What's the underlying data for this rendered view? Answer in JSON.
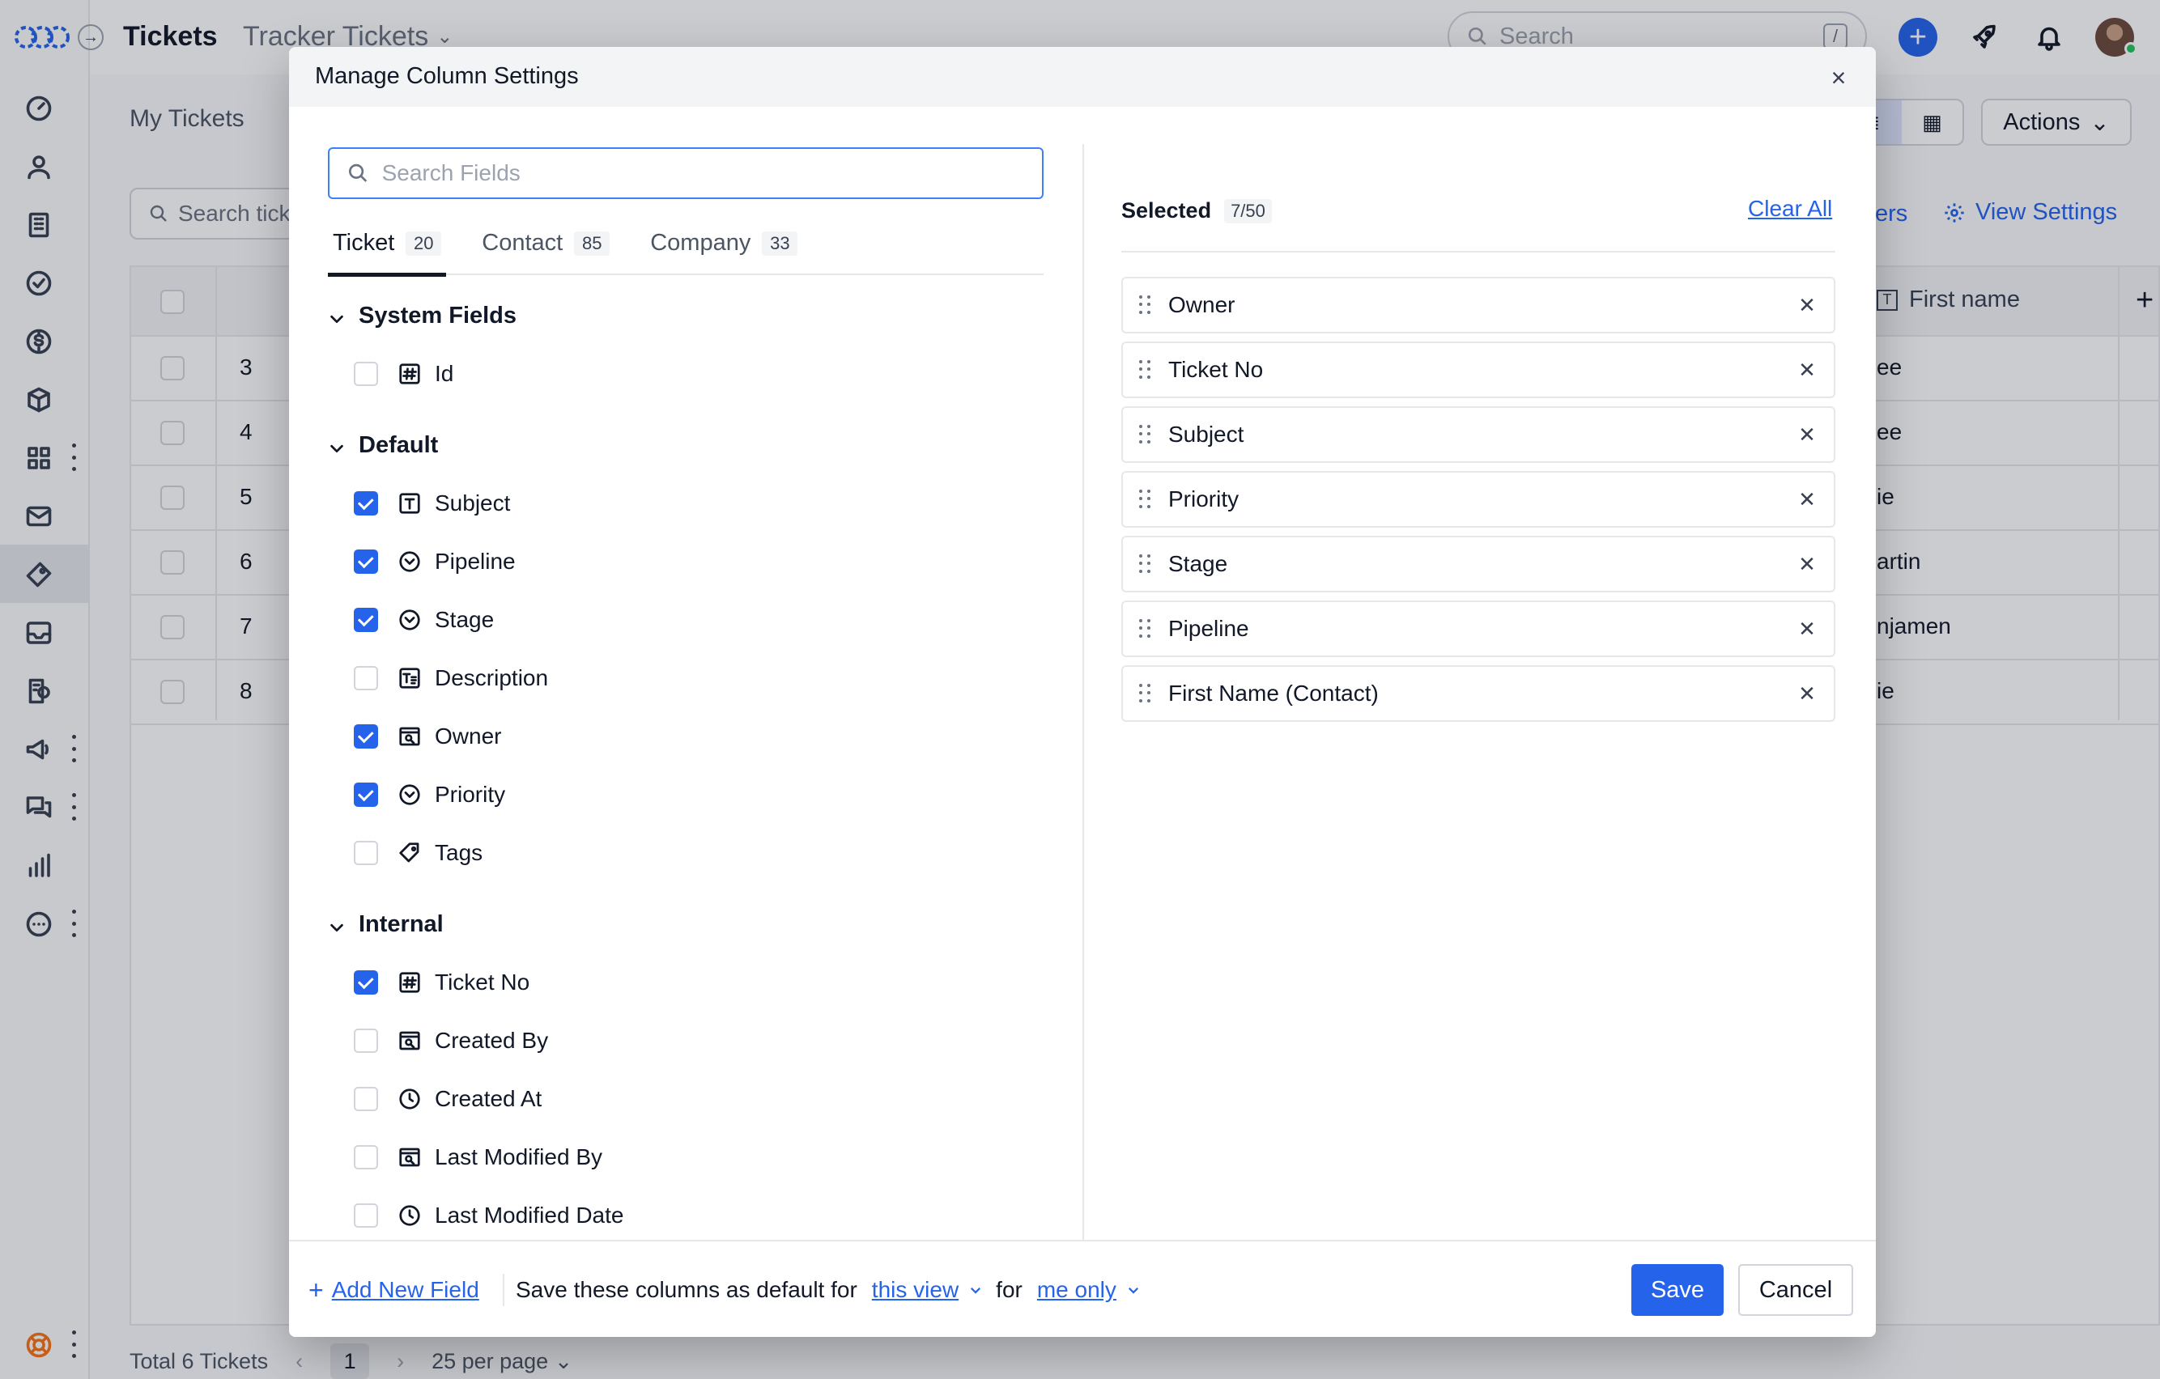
{
  "app": {
    "title": "Tickets",
    "view_title": "Tracker Tickets",
    "search_placeholder": "Search",
    "search_shortcut": "/"
  },
  "background": {
    "tabs": [
      "My Tickets"
    ],
    "search_placeholder": "Search tick",
    "actions_label": "Actions",
    "link_fragment": "ers",
    "view_settings_label": "View Settings",
    "column_first_name": "First name",
    "rows": [
      {
        "num": "3",
        "frag": "ee"
      },
      {
        "num": "4",
        "frag": "ee"
      },
      {
        "num": "5",
        "frag": "ie"
      },
      {
        "num": "6",
        "frag": "artin"
      },
      {
        "num": "7",
        "frag": "njamen"
      },
      {
        "num": "8",
        "frag": "ie"
      }
    ],
    "footer_total": "Total 6 Tickets",
    "footer_page": "1",
    "footer_per_page": "25 per page"
  },
  "modal": {
    "title": "Manage Column Settings",
    "search_placeholder": "Search Fields",
    "tabs": [
      {
        "label": "Ticket",
        "count": "20",
        "active": true
      },
      {
        "label": "Contact",
        "count": "85",
        "active": false
      },
      {
        "label": "Company",
        "count": "33",
        "active": false
      }
    ],
    "groups": [
      {
        "title": "System Fields",
        "fields": [
          {
            "label": "Id",
            "icon": "hash-icon",
            "checked": false
          }
        ]
      },
      {
        "title": "Default",
        "fields": [
          {
            "label": "Subject",
            "icon": "text-icon",
            "checked": true
          },
          {
            "label": "Pipeline",
            "icon": "dropdown-icon",
            "checked": true
          },
          {
            "label": "Stage",
            "icon": "dropdown-icon",
            "checked": true
          },
          {
            "label": "Description",
            "icon": "long-text-icon",
            "checked": false
          },
          {
            "label": "Owner",
            "icon": "user-lookup-icon",
            "checked": true
          },
          {
            "label": "Priority",
            "icon": "dropdown-icon",
            "checked": true
          },
          {
            "label": "Tags",
            "icon": "tag-icon",
            "checked": false
          }
        ]
      },
      {
        "title": "Internal",
        "fields": [
          {
            "label": "Ticket No",
            "icon": "hash-icon",
            "checked": true
          },
          {
            "label": "Created By",
            "icon": "user-lookup-icon",
            "checked": false
          },
          {
            "label": "Created At",
            "icon": "clock-icon",
            "checked": false
          },
          {
            "label": "Last Modified By",
            "icon": "user-lookup-icon",
            "checked": false
          },
          {
            "label": "Last Modified Date",
            "icon": "clock-icon",
            "checked": false
          }
        ]
      }
    ],
    "selected_label": "Selected",
    "selected_count": "7/50",
    "clear_all_label": "Clear All",
    "selected": [
      "Owner",
      "Ticket No",
      "Subject",
      "Priority",
      "Stage",
      "Pipeline",
      "First Name (Contact)"
    ],
    "footer": {
      "add_new_field": "Add New Field",
      "save_default_text": "Save these columns as default for",
      "view_option": "this view",
      "for_text": "for",
      "scope_option": "me only",
      "save_label": "Save",
      "cancel_label": "Cancel"
    }
  }
}
